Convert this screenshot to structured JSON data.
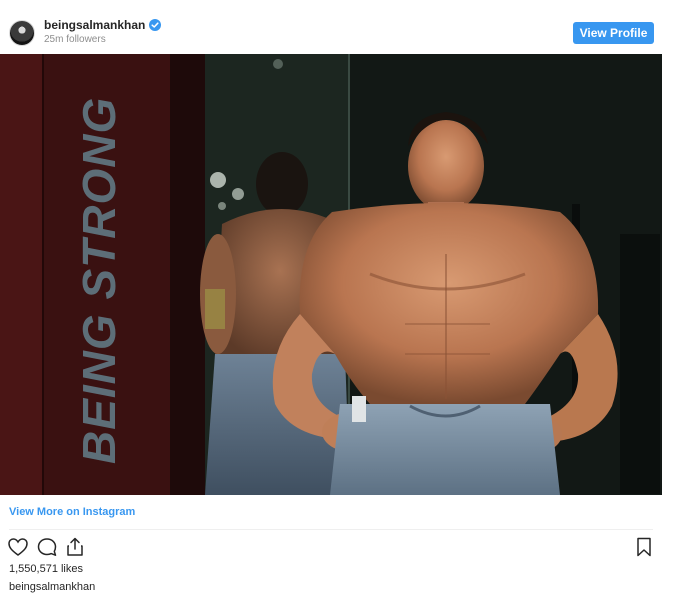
{
  "header": {
    "username": "beingsalmankhan",
    "followers": "25m followers",
    "view_profile_label": "View Profile",
    "avatar_icon": "profile-avatar",
    "verified_icon": "verified-badge-icon"
  },
  "photo": {
    "wall_text": "BEING STRONG"
  },
  "links": {
    "view_more": "View More on Instagram"
  },
  "actions": {
    "like_icon": "heart-icon",
    "comment_icon": "comment-icon",
    "share_icon": "share-icon",
    "save_icon": "bookmark-icon"
  },
  "post": {
    "likes": "1,550,571 likes",
    "caption_username": "beingsalmankhan"
  },
  "colors": {
    "accent": "#3897f0",
    "text": "#262626",
    "muted": "#8e8e8e"
  }
}
